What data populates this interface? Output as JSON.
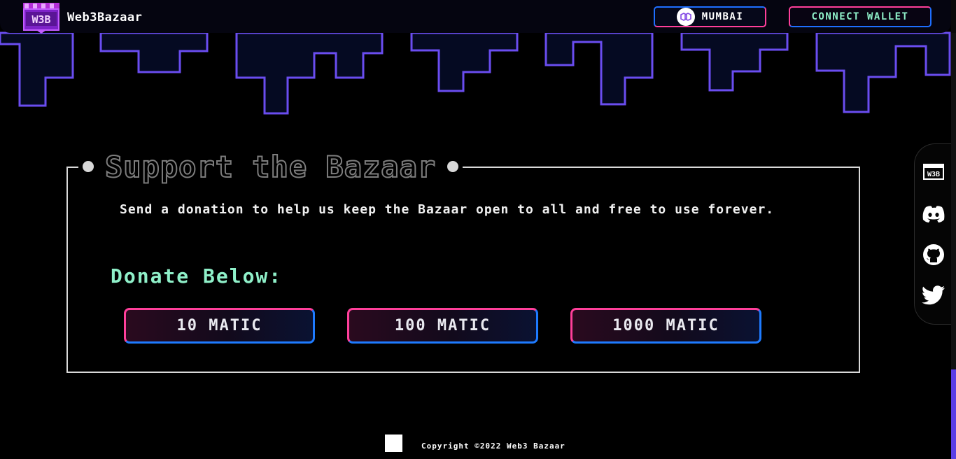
{
  "header": {
    "brand_name": "Web3Bazaar",
    "logo_text": "W3B",
    "network_label": "MUMBAI",
    "network_icon": "polygon-icon",
    "wallet_label": "CONNECT WALLET"
  },
  "support": {
    "title": "Support the Bazaar",
    "description": "Send a donation to help us keep the Bazaar open to all and free to use forever.",
    "donate_heading": "Donate Below:",
    "buttons": [
      "10 MATIC",
      "100 MATIC",
      "1000 MATIC"
    ]
  },
  "social": {
    "items": [
      "w3b-icon",
      "discord-icon",
      "github-icon",
      "twitter-icon"
    ],
    "w3b_text": "W3B"
  },
  "footer": {
    "copyright": "Copyright ©2022 Web3 Bazaar"
  },
  "colors": {
    "accent_purple": "#6b4cff",
    "accent_mint": "#8ff0c9",
    "accent_pink": "#ff3f9a",
    "accent_blue": "#1e6fff"
  }
}
